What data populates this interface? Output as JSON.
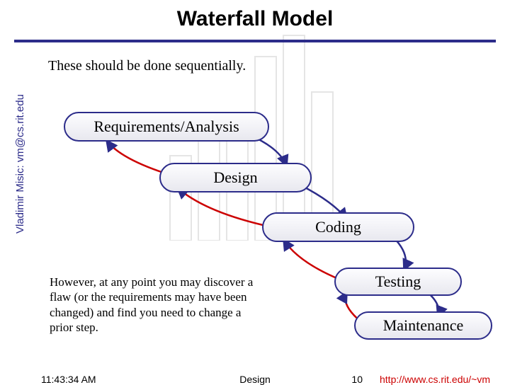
{
  "title": "Waterfall Model",
  "subtitle": "These should be done sequentially.",
  "sidebar": "Vladimir Misic: vm@cs.rit.edu",
  "stages": {
    "requirements": "Requirements/Analysis",
    "design": "Design",
    "coding": "Coding",
    "testing": "Testing",
    "maintenance": "Maintenance"
  },
  "note": "However, at any point you may discover a flaw (or the requirements may have been changed) and find you need to change a prior step.",
  "footer": {
    "time": "11:43:34 AM",
    "center": "Design",
    "page": "10",
    "url": "http://www.cs.rit.edu/~vm"
  }
}
